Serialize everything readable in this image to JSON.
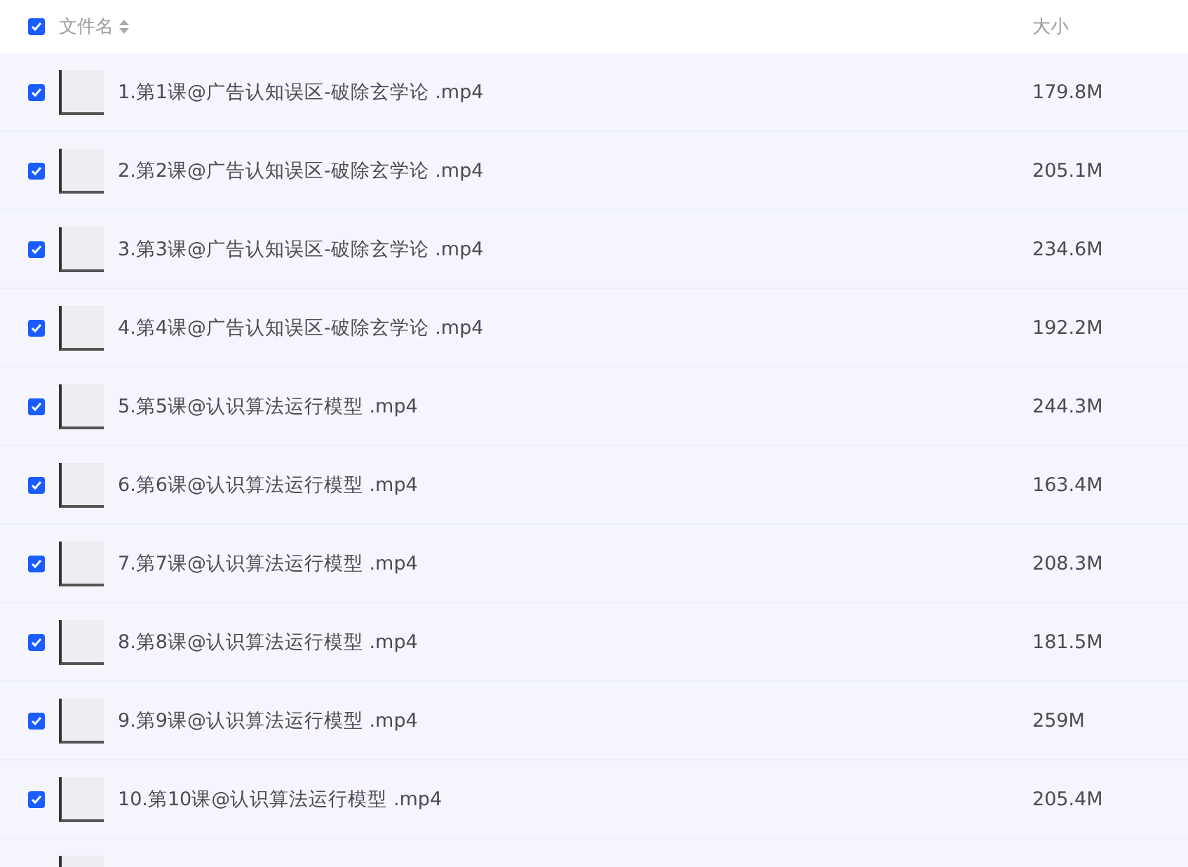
{
  "header": {
    "checked": true,
    "name_label": "文件名",
    "size_label": "大小"
  },
  "files": [
    {
      "name": "1.第1课@广告认知误区-破除玄学论 .mp4",
      "size": "179.8M",
      "checked": true
    },
    {
      "name": "2.第2课@广告认知误区-破除玄学论 .mp4",
      "size": "205.1M",
      "checked": true
    },
    {
      "name": "3.第3课@广告认知误区-破除玄学论 .mp4",
      "size": "234.6M",
      "checked": true
    },
    {
      "name": "4.第4课@广告认知误区-破除玄学论 .mp4",
      "size": "192.2M",
      "checked": true
    },
    {
      "name": "5.第5课@认识算法运行模型 .mp4",
      "size": "244.3M",
      "checked": true
    },
    {
      "name": "6.第6课@认识算法运行模型 .mp4",
      "size": "163.4M",
      "checked": true
    },
    {
      "name": "7.第7课@认识算法运行模型 .mp4",
      "size": "208.3M",
      "checked": true
    },
    {
      "name": "8.第8课@认识算法运行模型 .mp4",
      "size": "181.5M",
      "checked": true
    },
    {
      "name": "9.第9课@认识算法运行模型 .mp4",
      "size": "259M",
      "checked": true
    },
    {
      "name": "10.第10课@认识算法运行模型 .mp4",
      "size": "205.4M",
      "checked": true
    }
  ],
  "more_rows_below": true
}
